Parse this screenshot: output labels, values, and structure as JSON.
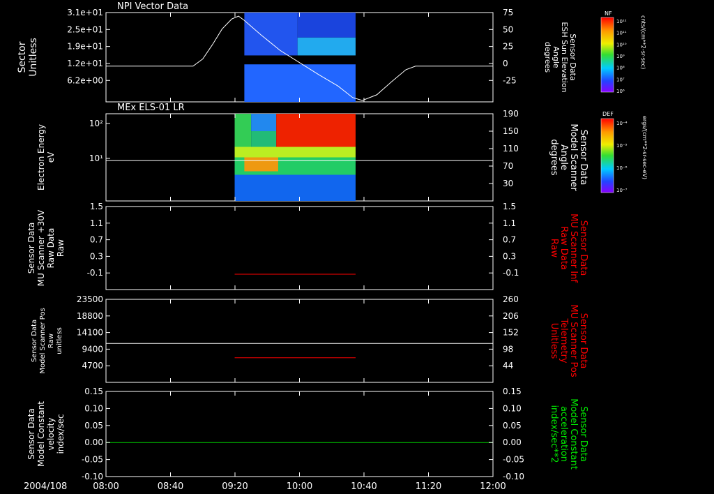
{
  "time_axis": {
    "date_label": "2004/108",
    "ticks": [
      "08:00",
      "08:40",
      "09:20",
      "10:00",
      "10:40",
      "11:20",
      "12:00"
    ],
    "range_hours": [
      8.0,
      12.0
    ]
  },
  "colorbars": [
    {
      "tag": "NF",
      "unit": "cnts/(cm**2-sr-sec)",
      "ticks": [
        "10¹²",
        "10¹¹",
        "10¹⁰",
        "10⁹",
        "10⁸",
        "10⁷",
        "10⁶"
      ]
    },
    {
      "tag": "DEF",
      "unit": "ergs/(cm**2-sr-sec-eV)",
      "ticks": [
        "10⁻⁴",
        "10⁻⁵",
        "10⁻⁶",
        "10⁻⁷"
      ]
    }
  ],
  "chart_data": [
    {
      "type": "heatmap",
      "title": "NPI Vector Data",
      "ylabel": [
        "Sector",
        "Unitless"
      ],
      "ylabel_right": [
        "Sensor Data",
        "ESH Sun Elevation",
        "Angle",
        "degrees"
      ],
      "yticks": [
        "3.1e+01",
        "2.5e+01",
        "1.9e+01",
        "1.2e+01",
        "6.2e+00"
      ],
      "yticks_right": [
        "75",
        "50",
        "25",
        "0",
        "-25"
      ],
      "ylim_right": [
        -50,
        75
      ],
      "heatmap_blocks": [
        {
          "t0": 9.43,
          "t1": 9.98,
          "y0": 0.52,
          "y1": 1.0,
          "color": "#2255ee"
        },
        {
          "t0": 9.98,
          "t1": 10.58,
          "y0": 0.72,
          "y1": 1.0,
          "color": "#1a44dd"
        },
        {
          "t0": 9.98,
          "t1": 10.58,
          "y0": 0.52,
          "y1": 0.72,
          "color": "#22aaee"
        },
        {
          "t0": 9.43,
          "t1": 10.58,
          "y0": 0.0,
          "y1": 0.42,
          "color": "#2266ff"
        }
      ],
      "line_series": {
        "name": "",
        "color": "#ffffff",
        "t": [
          8.0,
          8.9,
          9.0,
          9.1,
          9.2,
          9.3,
          9.37,
          9.43,
          9.6,
          9.8,
          10.0,
          10.2,
          10.4,
          10.55,
          10.65,
          10.8,
          10.95,
          11.1,
          11.2,
          11.3,
          12.0
        ],
        "v": [
          0,
          0,
          10,
          30,
          52,
          66,
          70,
          64,
          44,
          22,
          5,
          -12,
          -28,
          -44,
          -48,
          -40,
          -22,
          -5,
          0,
          0,
          0
        ]
      }
    },
    {
      "type": "heatmap",
      "title": "MEx ELS-01 LR",
      "ylabel": [
        "Electron Energy",
        "eV"
      ],
      "ylabel_right": [
        "Sensor Data",
        "Model Scanner",
        "Angle",
        "degrees"
      ],
      "yticks": [
        "10²",
        "10¹"
      ],
      "yticks_right": [
        "190",
        "150",
        "110",
        "70",
        "30"
      ],
      "ylim_right": [
        0,
        190
      ],
      "heatmap_blocks": [
        {
          "t0": 9.33,
          "t1": 10.58,
          "y0": 0.0,
          "y1": 0.3,
          "color": "#1166ee"
        },
        {
          "t0": 9.33,
          "t1": 10.58,
          "y0": 0.3,
          "y1": 0.5,
          "color": "#22cc66"
        },
        {
          "t0": 9.33,
          "t1": 10.58,
          "y0": 0.5,
          "y1": 0.62,
          "color": "#bbee22"
        },
        {
          "t0": 9.33,
          "t1": 9.5,
          "y0": 0.62,
          "y1": 1.0,
          "color": "#33cc55"
        },
        {
          "t0": 9.5,
          "t1": 9.76,
          "y0": 0.8,
          "y1": 1.0,
          "color": "#2288ee"
        },
        {
          "t0": 9.5,
          "t1": 9.76,
          "y0": 0.62,
          "y1": 0.8,
          "color": "#22bb77"
        },
        {
          "t0": 9.76,
          "t1": 10.58,
          "y0": 0.62,
          "y1": 1.0,
          "color": "#ee2200"
        },
        {
          "t0": 9.43,
          "t1": 9.78,
          "y0": 0.34,
          "y1": 0.5,
          "color": "#ee9911"
        }
      ],
      "line_series": {
        "name": "",
        "color": "#ffffff",
        "t": [
          8.0,
          12.0
        ],
        "v": [
          88,
          88
        ]
      }
    },
    {
      "type": "line",
      "ylabel": [
        "Sensor Data",
        "MU Scanner +30V",
        "Raw Data",
        "Raw"
      ],
      "ylabel_right": [
        "Sensor Data",
        "MU Scanner Inf",
        "Raw Data",
        "Raw"
      ],
      "ylabel_right_color": "#ff0000",
      "yticks": [
        "1.5",
        "1.1",
        "0.7",
        "0.3",
        "-0.1"
      ],
      "yticks_right": [
        "1.5",
        "1.1",
        "0.7",
        "0.3",
        "-0.1"
      ],
      "ylim": [
        -0.34,
        1.5
      ],
      "series": [
        {
          "name": "",
          "color": "#ff0000",
          "t": [
            9.33,
            10.58
          ],
          "v": [
            0.0,
            0.0
          ]
        }
      ]
    },
    {
      "type": "line",
      "ylabel": [
        "Sensor Data",
        "Model Scanner Pos",
        "Raw",
        "unitless"
      ],
      "ylabel_right": [
        "Sensor Data",
        "MU Scanner Pos",
        "Telemetry",
        "Unitless"
      ],
      "ylabel_right_color": "#ff0000",
      "yticks": [
        "23500",
        "18800",
        "14100",
        "9400",
        "4700"
      ],
      "yticks_right": [
        "260",
        "206",
        "152",
        "98",
        "44"
      ],
      "ylim": [
        0,
        23500
      ],
      "ylim_right": [
        17,
        260
      ],
      "series": [
        {
          "name": "",
          "color": "#ffffff",
          "axis": "left",
          "t": [
            8.0,
            12.0
          ],
          "v": [
            11000,
            11000
          ]
        },
        {
          "name": "",
          "color": "#ff0000",
          "axis": "right",
          "t": [
            9.33,
            10.58
          ],
          "v": [
            89,
            89
          ]
        }
      ]
    },
    {
      "type": "line",
      "ylabel": [
        "Sensor Data",
        "Model Constant",
        "velocity",
        "index/sec"
      ],
      "ylabel_right": [
        "Sensor Data",
        "Model Constant",
        "acceleration",
        "index/sec**2"
      ],
      "ylabel_right_color": "#00ee00",
      "yticks": [
        "0.15",
        "0.10",
        "0.05",
        "0.00",
        "-0.05",
        "-0.10"
      ],
      "yticks_right": [
        "0.15",
        "0.10",
        "0.05",
        "0.00",
        "-0.05",
        "-0.10"
      ],
      "ylim": [
        -0.1,
        0.15
      ],
      "series": [
        {
          "name": "",
          "color": "#00cc00",
          "t": [
            8.0,
            12.0
          ],
          "v": [
            0.0,
            0.0
          ]
        }
      ]
    }
  ]
}
